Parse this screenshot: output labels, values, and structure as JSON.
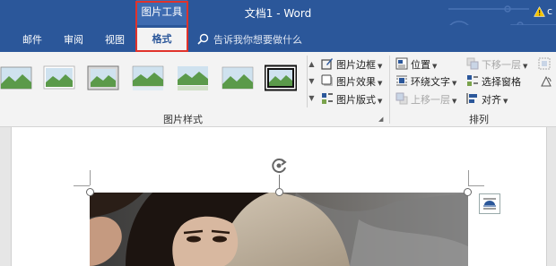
{
  "title_bar": {
    "contextual_tool": "图片工具",
    "document_title": "文档1 - Word",
    "account_text": "c"
  },
  "tabs": [
    {
      "label": "邮件"
    },
    {
      "label": "审阅"
    },
    {
      "label": "视图"
    },
    {
      "label": "格式",
      "active": true
    }
  ],
  "tell_me": {
    "placeholder": "告诉我你想要做什么"
  },
  "ribbon": {
    "picture_styles": {
      "label": "图片样式",
      "thumbnails": [
        "style-1",
        "style-2",
        "style-3",
        "style-4",
        "style-5",
        "style-6",
        "style-7"
      ],
      "selected_index": 6,
      "commands": [
        {
          "label": "图片边框",
          "icon": "picture-border-icon"
        },
        {
          "label": "图片效果",
          "icon": "picture-effects-icon"
        },
        {
          "label": "图片版式",
          "icon": "picture-layout-icon"
        }
      ]
    },
    "arrange": {
      "label": "排列",
      "commands": [
        {
          "label": "位置",
          "icon": "position-icon",
          "enabled": true
        },
        {
          "label": "环绕文字",
          "icon": "wrap-text-icon",
          "enabled": true
        },
        {
          "label": "上移一层",
          "icon": "bring-forward-icon",
          "enabled": false
        },
        {
          "label": "下移一层",
          "icon": "send-backward-icon",
          "enabled": false
        },
        {
          "label": "选择窗格",
          "icon": "selection-pane-icon",
          "enabled": true
        },
        {
          "label": "对齐",
          "icon": "align-icon",
          "enabled": true
        }
      ]
    }
  },
  "colors": {
    "accent": "#2b579a",
    "highlight": "#e0322b",
    "ribbon_bg": "#f3f3f3"
  }
}
